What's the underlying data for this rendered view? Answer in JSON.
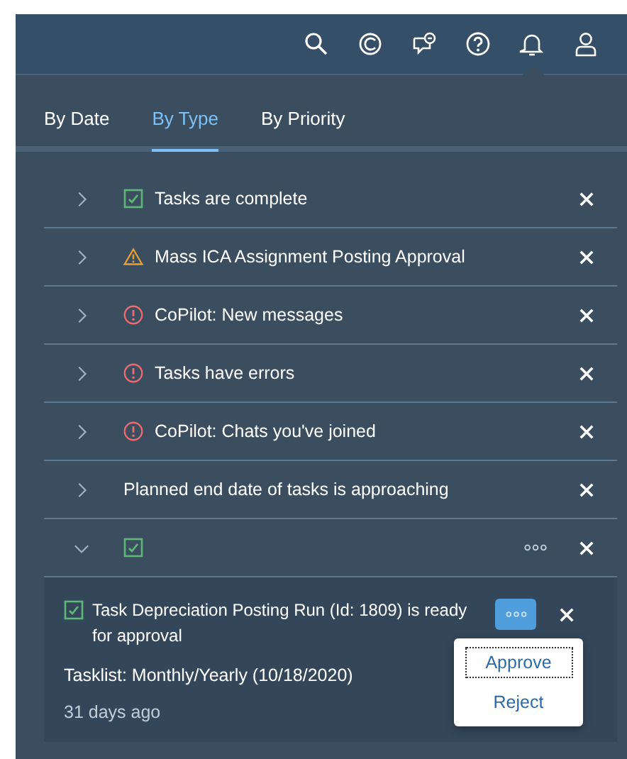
{
  "tabs": [
    {
      "label": "By Date",
      "selected": false
    },
    {
      "label": "By Type",
      "selected": true
    },
    {
      "label": "By Priority",
      "selected": false
    }
  ],
  "groups": [
    {
      "kind": "success",
      "title": "Tasks are complete",
      "expanded": false
    },
    {
      "kind": "warning",
      "title": "Mass ICA Assignment Posting Approval",
      "expanded": false
    },
    {
      "kind": "error",
      "title": "CoPilot: New messages",
      "expanded": false
    },
    {
      "kind": "error",
      "title": "Tasks have errors",
      "expanded": false
    },
    {
      "kind": "error",
      "title": "CoPilot: Chats you've joined",
      "expanded": false
    },
    {
      "kind": "none",
      "title": "Planned end date of tasks is approaching",
      "expanded": false
    },
    {
      "kind": "success",
      "expanded": true,
      "items": [
        {
          "kind": "success",
          "title": "Task Depreciation Posting Run (Id: 1809) is ready for approval",
          "tasklist": "Tasklist: Monthly/Yearly (10/18/2020)",
          "time": "31 days ago",
          "menu_open": true,
          "actions": [
            {
              "label": "Approve",
              "focused": true
            },
            {
              "label": "Reject",
              "focused": false
            }
          ]
        }
      ]
    }
  ]
}
